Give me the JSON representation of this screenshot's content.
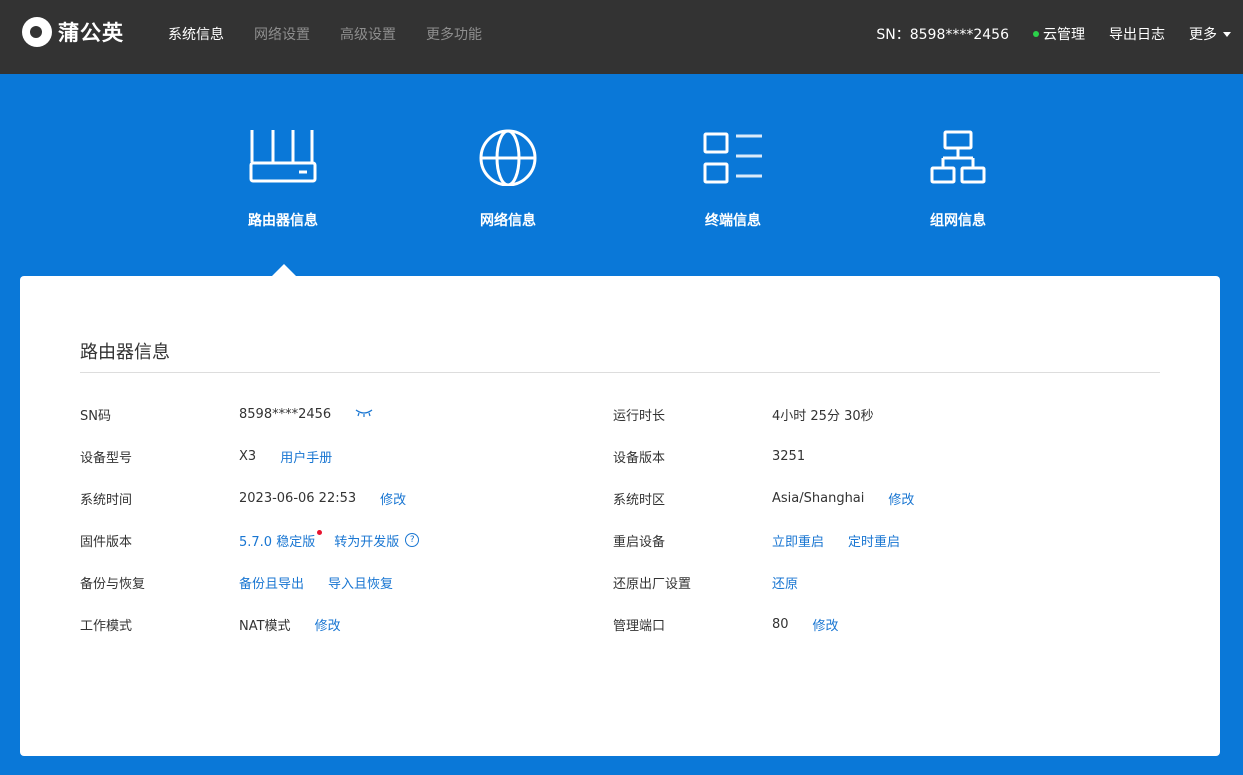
{
  "header": {
    "logo_text": "蒲公英",
    "nav": [
      "系统信息",
      "网络设置",
      "高级设置",
      "更多功能"
    ],
    "sn_label": "SN：8598****2456",
    "cloud_manage": "云管理",
    "export_log": "导出日志",
    "more": "更多"
  },
  "tabs": [
    "路由器信息",
    "网络信息",
    "终端信息",
    "组网信息"
  ],
  "card": {
    "title": "路由器信息",
    "left": [
      {
        "key": "SN码",
        "value": "8598****2456"
      },
      {
        "key": "设备型号",
        "value": "X3",
        "link": "用户手册"
      },
      {
        "key": "系统时间",
        "value": "2023-06-06 22:53",
        "link": "修改"
      },
      {
        "key": "固件版本",
        "link1": "5.7.0 稳定版",
        "link2": "转为开发版"
      },
      {
        "key": "备份与恢复",
        "link1": "备份且导出",
        "link2": "导入且恢复"
      },
      {
        "key": "工作模式",
        "value": "NAT模式",
        "link": "修改"
      }
    ],
    "right": [
      {
        "key": "运行时长",
        "value": "4小时 25分 30秒"
      },
      {
        "key": "设备版本",
        "value": "3251"
      },
      {
        "key": "系统时区",
        "value": "Asia/Shanghai",
        "link": "修改"
      },
      {
        "key": "重启设备",
        "link1": "立即重启",
        "link2": "定时重启"
      },
      {
        "key": "还原出厂设置",
        "link1": "还原"
      },
      {
        "key": "管理端口",
        "value": "80",
        "link": "修改"
      }
    ]
  },
  "colors": {
    "topbar": "#333333",
    "primary_blue": "#0a78d8",
    "link": "#1976d2",
    "status_green": "#2bd24a"
  }
}
